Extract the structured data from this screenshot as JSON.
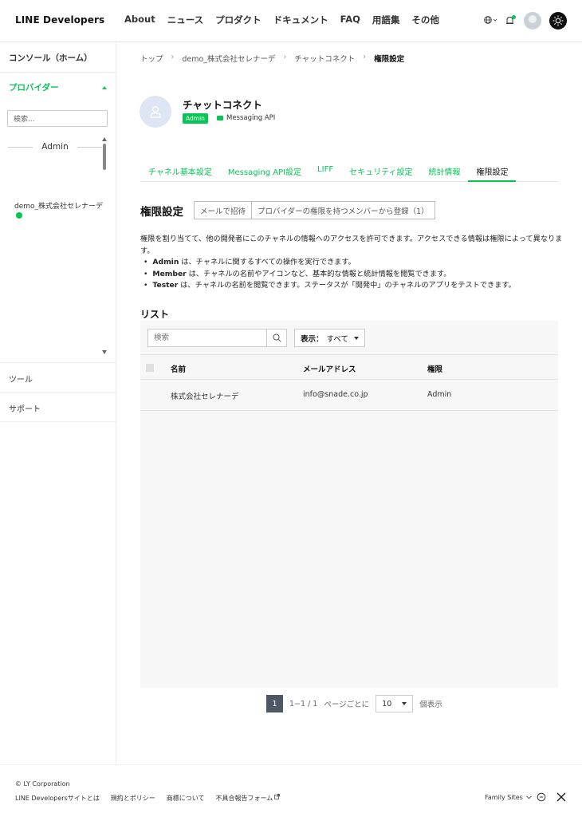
{
  "header": {
    "logo": "LINE Developers",
    "nav": [
      "About",
      "ニュース",
      "プロダクト",
      "ドキュメント",
      "FAQ",
      "用語集",
      "その他"
    ]
  },
  "sidebar": {
    "console": "コンソール（ホーム）",
    "providers_label": "プロバイダー",
    "search_placeholder": "検索...",
    "role_header": "Admin",
    "provider_item": "demo_株式会社セレナーデ",
    "tools": "ツール",
    "support": "サポート"
  },
  "breadcrumb": [
    "トップ",
    "demo_株式会社セレナーデ",
    "チャットコネクト",
    "権限設定"
  ],
  "channel": {
    "name": "チャットコネクト",
    "badge": "Admin",
    "type": "Messaging API"
  },
  "tabs": [
    "チャネル基本設定",
    "Messaging API設定",
    "LIFF",
    "セキュリティ設定",
    "統計情報",
    "権限設定"
  ],
  "permissions": {
    "title": "権限設定",
    "invite_button": "メールで招待",
    "register_button": "プロバイダーの権限を持つメンバーから登録（1）",
    "intro": "権限を割り当てて、他の開発者にこのチャネルの情報へのアクセスを許可できます。アクセスできる情報は権限によって異なります。",
    "roles": [
      {
        "name": "Admin",
        "text": "は、チャネルに関するすべての操作を実行できます。"
      },
      {
        "name": "Member",
        "text": "は、チャネルの名前やアイコンなど、基本的な情報と統計情報を閲覧できます。"
      },
      {
        "name": "Tester",
        "text": "は、チャネルの名前を閲覧できます。ステータスが「開発中」のチャネルのアプリをテストできます。"
      }
    ]
  },
  "list": {
    "title": "リスト",
    "search_placeholder": "検索",
    "filter_label": "表示：",
    "filter_value": "すべて",
    "columns": [
      "名前",
      "メールアドレス",
      "権限"
    ],
    "rows": [
      {
        "name": "株式会社セレナーデ",
        "email": "info@snade.co.jp",
        "role": "Admin"
      }
    ]
  },
  "pagination": {
    "current": "1",
    "range": "1−1 / 1",
    "per_page_label": "ページごとに",
    "per_page": "10",
    "per_page_suffix": "個表示"
  },
  "footer": {
    "copyright": "© LY Corporation",
    "links": [
      "LINE Developersサイトとは",
      "規約とポリシー",
      "商標について",
      "不具合報告フォーム"
    ],
    "family_sites": "Family Sites"
  },
  "colors": {
    "accent": "#06c755",
    "pager": "#4d5766"
  }
}
